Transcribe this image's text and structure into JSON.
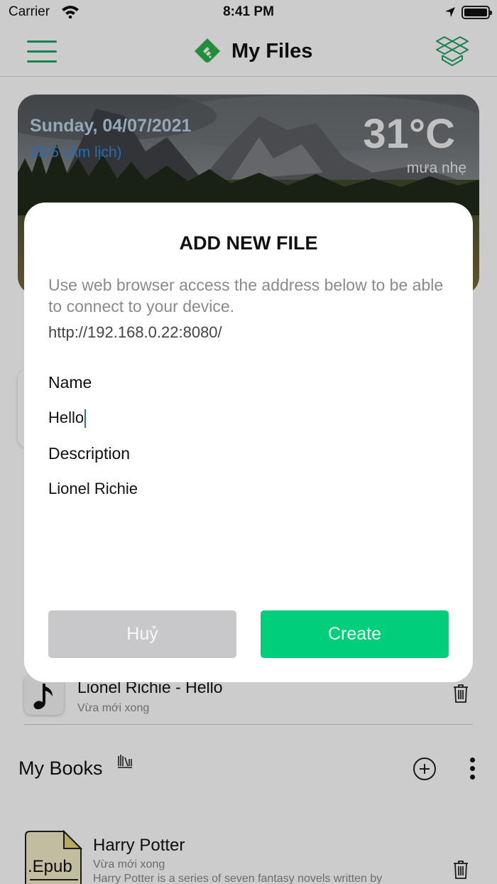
{
  "status_bar": {
    "carrier": "Carrier",
    "time": "8:41 PM"
  },
  "nav": {
    "title": "My Files",
    "accent_color": "#21a366",
    "left_icon": "hamburger-menu-icon",
    "right_icon": "boxes-icon"
  },
  "weather": {
    "date": "Sunday, 04/07/2021",
    "lunar_date": "25/5 (Âm lịch)",
    "temperature": "31°C",
    "condition": "mưa nhẹ"
  },
  "music": {
    "song_title": "Lionel Richie - Hello",
    "song_time": "Vừa mới xong"
  },
  "books": {
    "section_title": "My Books",
    "book_title": "Harry Potter",
    "book_time": "Vừa mới xong",
    "book_description": "Harry Potter is a series of seven fantasy novels written by",
    "thumb_label": ".Epub"
  },
  "dialog": {
    "title": "ADD NEW FILE",
    "info": "Use web browser access the address below to be able to connect to your device.",
    "url": "http://192.168.0.22:8080/",
    "name_label": "Name",
    "name_value": "Hello",
    "description_label": "Description",
    "description_value": "Lionel Richie",
    "cancel_label": "Huỷ",
    "create_label": "Create",
    "create_color": "#00ce7b",
    "cancel_color": "#c8c8ca"
  }
}
